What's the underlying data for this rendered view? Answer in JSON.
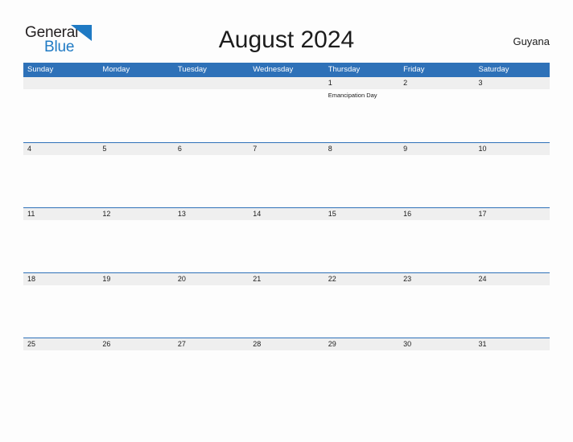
{
  "brand": {
    "name_part1": "General",
    "name_part2": "Blue",
    "flag_icon": "triangle-flag-icon",
    "color_dark": "#231f20",
    "color_blue": "#1f7ac4"
  },
  "header": {
    "title": "August 2024",
    "country": "Guyana"
  },
  "theme": {
    "header_blue": "#2e71b8",
    "band_gray": "#efefef",
    "page_background": "#fdfdfd",
    "text_dark": "#1c1c1c"
  },
  "weekdays": [
    "Sunday",
    "Monday",
    "Tuesday",
    "Wednesday",
    "Thursday",
    "Friday",
    "Saturday"
  ],
  "weeks": [
    {
      "days": [
        {
          "date": "",
          "events": []
        },
        {
          "date": "",
          "events": []
        },
        {
          "date": "",
          "events": []
        },
        {
          "date": "",
          "events": []
        },
        {
          "date": "1",
          "events": [
            "Emancipation Day"
          ]
        },
        {
          "date": "2",
          "events": []
        },
        {
          "date": "3",
          "events": []
        }
      ]
    },
    {
      "days": [
        {
          "date": "4",
          "events": []
        },
        {
          "date": "5",
          "events": []
        },
        {
          "date": "6",
          "events": []
        },
        {
          "date": "7",
          "events": []
        },
        {
          "date": "8",
          "events": []
        },
        {
          "date": "9",
          "events": []
        },
        {
          "date": "10",
          "events": []
        }
      ]
    },
    {
      "days": [
        {
          "date": "11",
          "events": []
        },
        {
          "date": "12",
          "events": []
        },
        {
          "date": "13",
          "events": []
        },
        {
          "date": "14",
          "events": []
        },
        {
          "date": "15",
          "events": []
        },
        {
          "date": "16",
          "events": []
        },
        {
          "date": "17",
          "events": []
        }
      ]
    },
    {
      "days": [
        {
          "date": "18",
          "events": []
        },
        {
          "date": "19",
          "events": []
        },
        {
          "date": "20",
          "events": []
        },
        {
          "date": "21",
          "events": []
        },
        {
          "date": "22",
          "events": []
        },
        {
          "date": "23",
          "events": []
        },
        {
          "date": "24",
          "events": []
        }
      ]
    },
    {
      "days": [
        {
          "date": "25",
          "events": []
        },
        {
          "date": "26",
          "events": []
        },
        {
          "date": "27",
          "events": []
        },
        {
          "date": "28",
          "events": []
        },
        {
          "date": "29",
          "events": []
        },
        {
          "date": "30",
          "events": []
        },
        {
          "date": "31",
          "events": []
        }
      ]
    }
  ]
}
